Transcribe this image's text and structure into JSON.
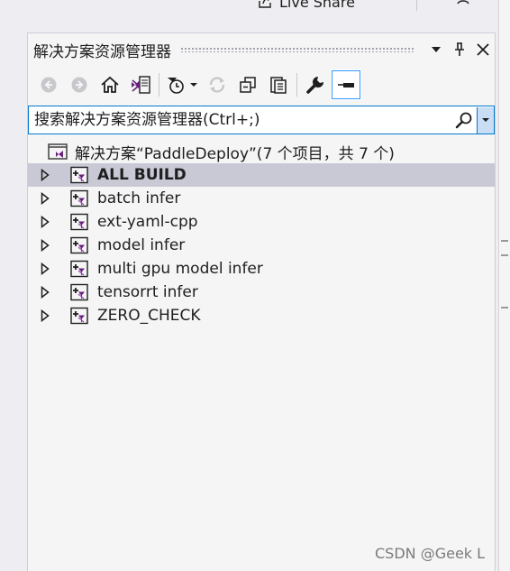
{
  "topbar": {
    "live_share_label": "Live Share",
    "icons": [
      "live-share-icon",
      "user-icon"
    ]
  },
  "panel": {
    "title": "解决方案资源管理器",
    "title_icons": [
      "dropdown-arrow-icon",
      "pin-icon",
      "close-icon"
    ],
    "toolbar_icons": [
      "back-icon",
      "forward-icon",
      "home-icon",
      "switch-views-icon",
      "pending-changes-filter-icon",
      "dropdown-icon",
      "refresh-icon",
      "collapse-all-icon",
      "show-all-files-icon",
      "properties-wrench-icon",
      "preview-selected-icon"
    ]
  },
  "search": {
    "placeholder": "搜索解决方案资源管理器(Ctrl+;)",
    "value": ""
  },
  "tree": {
    "solution_label": "解决方案“PaddleDeploy”(7 个项目，共 7 个)",
    "projects": [
      {
        "label": "ALL BUILD",
        "selected": true
      },
      {
        "label": "batch infer",
        "selected": false
      },
      {
        "label": "ext-yaml-cpp",
        "selected": false
      },
      {
        "label": "model infer",
        "selected": false
      },
      {
        "label": "multi gpu model infer",
        "selected": false
      },
      {
        "label": "tensorrt infer",
        "selected": false
      },
      {
        "label": "ZERO_CHECK",
        "selected": false
      }
    ]
  },
  "watermark": "CSDN @Geek L",
  "colors": {
    "accent": "#007acc",
    "selection": "#c9c9d6",
    "vs_purple": "#68217a",
    "project_icon_border": "#a04fb8"
  }
}
